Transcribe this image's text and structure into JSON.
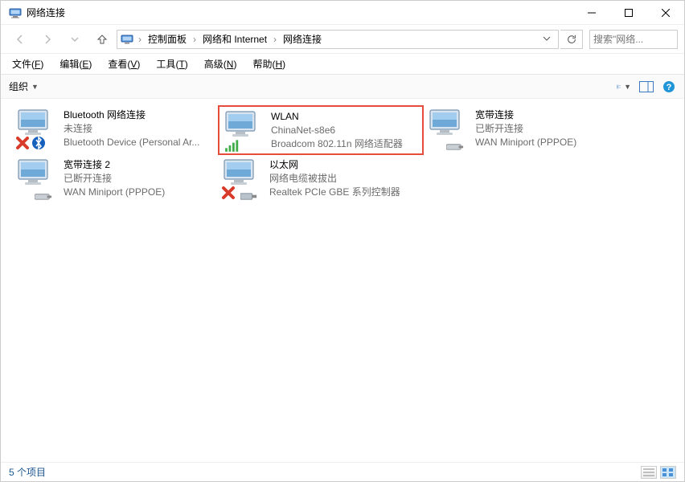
{
  "window": {
    "title": "网络连接"
  },
  "breadcrumb": {
    "item1": "控制面板",
    "item2": "网络和 Internet",
    "item3": "网络连接"
  },
  "search": {
    "placeholder": "搜索\"网络..."
  },
  "menu": {
    "file": {
      "label": "文件",
      "accel": "F"
    },
    "edit": {
      "label": "编辑",
      "accel": "E"
    },
    "view": {
      "label": "查看",
      "accel": "V"
    },
    "tools": {
      "label": "工具",
      "accel": "T"
    },
    "advanced": {
      "label": "高级",
      "accel": "N"
    },
    "help": {
      "label": "帮助",
      "accel": "H"
    }
  },
  "toolbar": {
    "organize": "组织"
  },
  "connections": [
    {
      "name": "Bluetooth 网络连接",
      "status": "未连接",
      "device": "Bluetooth Device (Personal Ar...",
      "icon": "bluetooth",
      "disabled": true
    },
    {
      "name": "WLAN",
      "status": "ChinaNet-s8e6",
      "device": "Broadcom 802.11n 网络适配器",
      "icon": "wifi",
      "disabled": false,
      "highlight": true
    },
    {
      "name": "宽带连接",
      "status": "已断开连接",
      "device": "WAN Miniport (PPPOE)",
      "icon": "modem",
      "disabled": false
    },
    {
      "name": "宽带连接 2",
      "status": "已断开连接",
      "device": "WAN Miniport (PPPOE)",
      "icon": "modem",
      "disabled": false
    },
    {
      "name": "以太网",
      "status": "网络电缆被拔出",
      "device": "Realtek PCIe GBE 系列控制器",
      "icon": "ethernet",
      "disabled": true
    }
  ],
  "status": {
    "count": "5 个项目"
  }
}
